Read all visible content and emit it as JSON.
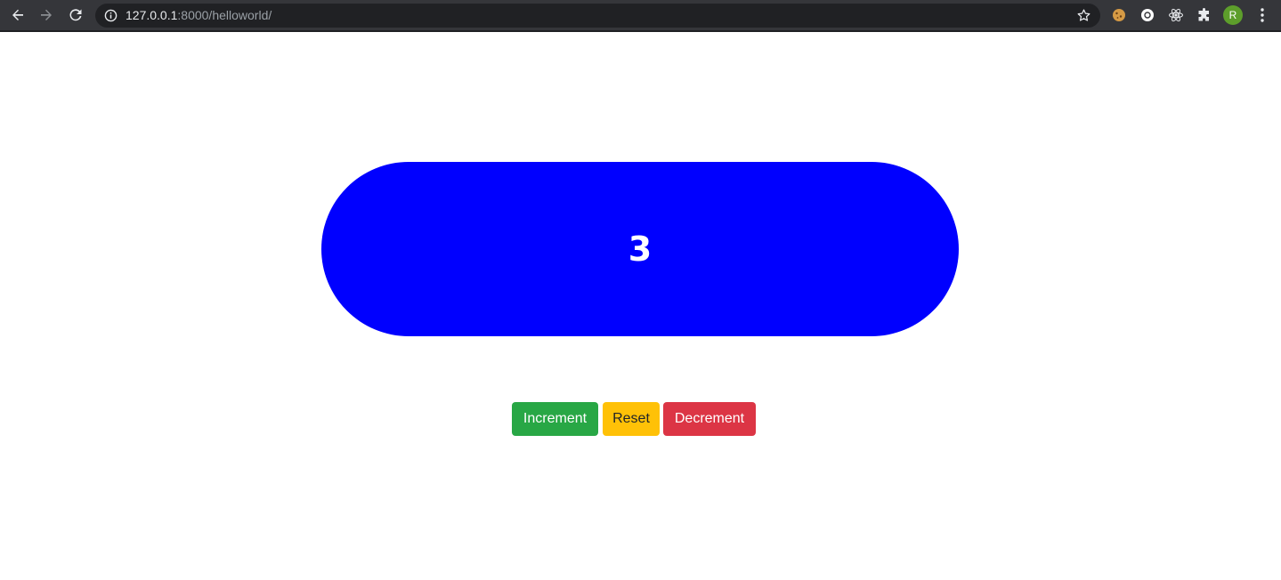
{
  "browser": {
    "url_host": "127.0.0.1",
    "url_rest": ":8000/helloworld/",
    "profile_initial": "R",
    "icons": [
      "back-icon",
      "forward-icon",
      "reload-icon",
      "info-icon",
      "star-icon",
      "cookie-icon",
      "extension-circle-icon",
      "react-icon",
      "puzzle-icon",
      "menu-icon"
    ]
  },
  "counter": {
    "value": "3",
    "color": "#0000ff"
  },
  "buttons": {
    "increment": "Increment",
    "reset": "Reset",
    "decrement": "Decrement"
  },
  "colors": {
    "increment": "#28a745",
    "reset": "#ffc107",
    "decrement": "#dc3545"
  }
}
